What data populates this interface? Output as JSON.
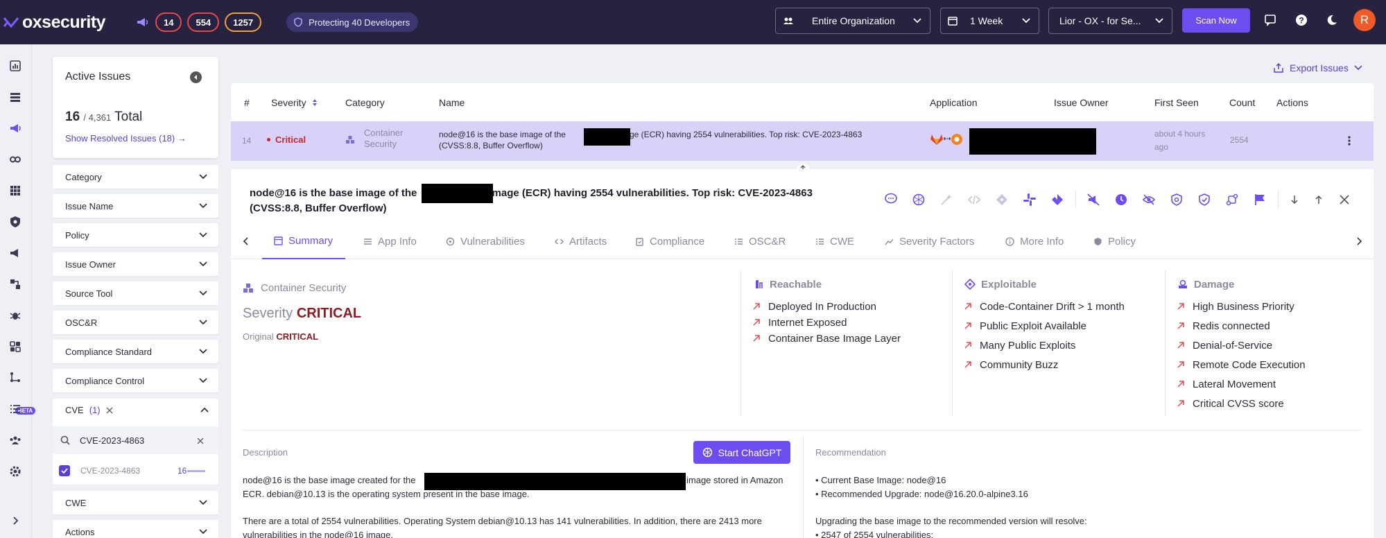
{
  "topbar": {
    "logo_text": "oxsecurity",
    "badges": [
      "14",
      "554",
      "1257"
    ],
    "protecting": "Protecting 40 Developers",
    "org_dropdown": "Entire Organization",
    "period_dropdown": "1 Week",
    "app_dropdown": "Lior - OX - for Se...",
    "scan_button": "Scan Now",
    "avatar_initial": "R"
  },
  "sidebar": {
    "beta_label": "BETA"
  },
  "filters": {
    "title": "Active Issues",
    "count_current": "16",
    "count_total": "/ 4,361",
    "count_suffix": "Total",
    "show_resolved": "Show Resolved Issues (18) →",
    "items_top": [
      "Category",
      "Issue Name",
      "Policy",
      "Issue Owner",
      "Source Tool",
      "OSC&R",
      "Compliance Standard",
      "Compliance Control"
    ],
    "cve": {
      "label": "CVE",
      "count": "(1)",
      "search_value": "CVE-2023-4863",
      "option_label": "CVE-2023-4863",
      "option_count": "16"
    },
    "items_bottom": [
      "CWE",
      "Actions"
    ]
  },
  "export_label": "Export Issues",
  "table": {
    "headers": [
      "#",
      "Severity",
      "Category",
      "Name",
      "Application",
      "Issue Owner",
      "First Seen",
      "Count",
      "Actions"
    ],
    "row": {
      "index": "14",
      "severity": "Critical",
      "category_line1": "Container",
      "category_line2": "Security",
      "name_part1": "node@16 is the base image of the",
      "name_part2": "' image (ECR) having 2554 vulnerabilities. Top risk: CVE-2023-4863",
      "name_line2": "(CVSS:8.8, Buffer Overflow)",
      "first_seen_line1": "about 4 hours",
      "first_seen_line2": "ago",
      "count": "2554"
    }
  },
  "detail": {
    "title_part1": "node@16 is the base image of the",
    "title_part2": "image (ECR) having 2554 vulnerabilities. Top risk: CVE-2023-4863",
    "title_line2": "(CVSS:8.8, Buffer Overflow)",
    "tabs": [
      "Summary",
      "App Info",
      "Vulnerabilities",
      "Artifacts",
      "Compliance",
      "OSC&R",
      "CWE",
      "Severity Factors",
      "More Info",
      "Policy"
    ],
    "category": "Container Security",
    "severity_label": "Severity",
    "severity_value": "CRITICAL",
    "original_label": "Original",
    "original_value": "CRITICAL",
    "reachable": {
      "title": "Reachable",
      "items": [
        "Deployed In Production",
        "Internet Exposed",
        "Container Base Image Layer"
      ]
    },
    "exploitable": {
      "title": "Exploitable",
      "items": [
        "Code-Container Drift > 1 month",
        "Public Exploit Available",
        "Many Public Exploits",
        "Community Buzz"
      ]
    },
    "damage": {
      "title": "Damage",
      "items": [
        "High Business Priority",
        "Redis connected",
        "Denial-of-Service",
        "Remote Code Execution",
        "Lateral Movement",
        "Critical CVSS score"
      ]
    },
    "description_label": "Description",
    "chatgpt_button": "Start ChatGPT",
    "desc_p1_a": "node@16 is the base image created for the",
    "desc_p1_b": "image stored in Amazon",
    "desc_p1_c": "ECR. debian@10.13 is the operating system present in the base image.",
    "desc_p2_a": "There are a total of 2554 vulnerabilities. Operating System debian@10.13 has 141 vulnerabilities. In addition, there are 2413 more",
    "desc_p2_b": "vulnerabilities in the node@16 image.",
    "recommendation_label": "Recommendation",
    "rec_1": "• Current Base Image: node@16",
    "rec_2": "• Recommended Upgrade: node@16.20.0-alpine3.16",
    "rec_3": "Upgrading the base image to the recommended version will resolve:",
    "rec_4": "• 2547 of 2554 vulnerabilities:"
  },
  "colors": {
    "topbar": "#26223f",
    "accent": "#6d4cf0",
    "critical": "#c0272d",
    "selected_row": "#d9d2f8"
  }
}
